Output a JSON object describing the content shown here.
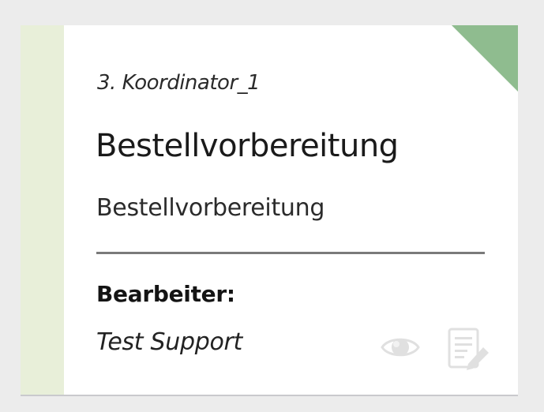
{
  "card": {
    "coordinator": "3. Koordinator_1",
    "title": "Bestellvorbereitung",
    "subtitle": "Bestellvorbereitung",
    "assignee_label": "Bearbeiter:",
    "assignee_name": "Test Support"
  },
  "icons": {
    "view": "eye-icon",
    "edit": "edit-document-icon"
  },
  "colors": {
    "stripe": "#e8efd9",
    "corner": "#8fbc8f",
    "icon": "#e0e0e0"
  }
}
